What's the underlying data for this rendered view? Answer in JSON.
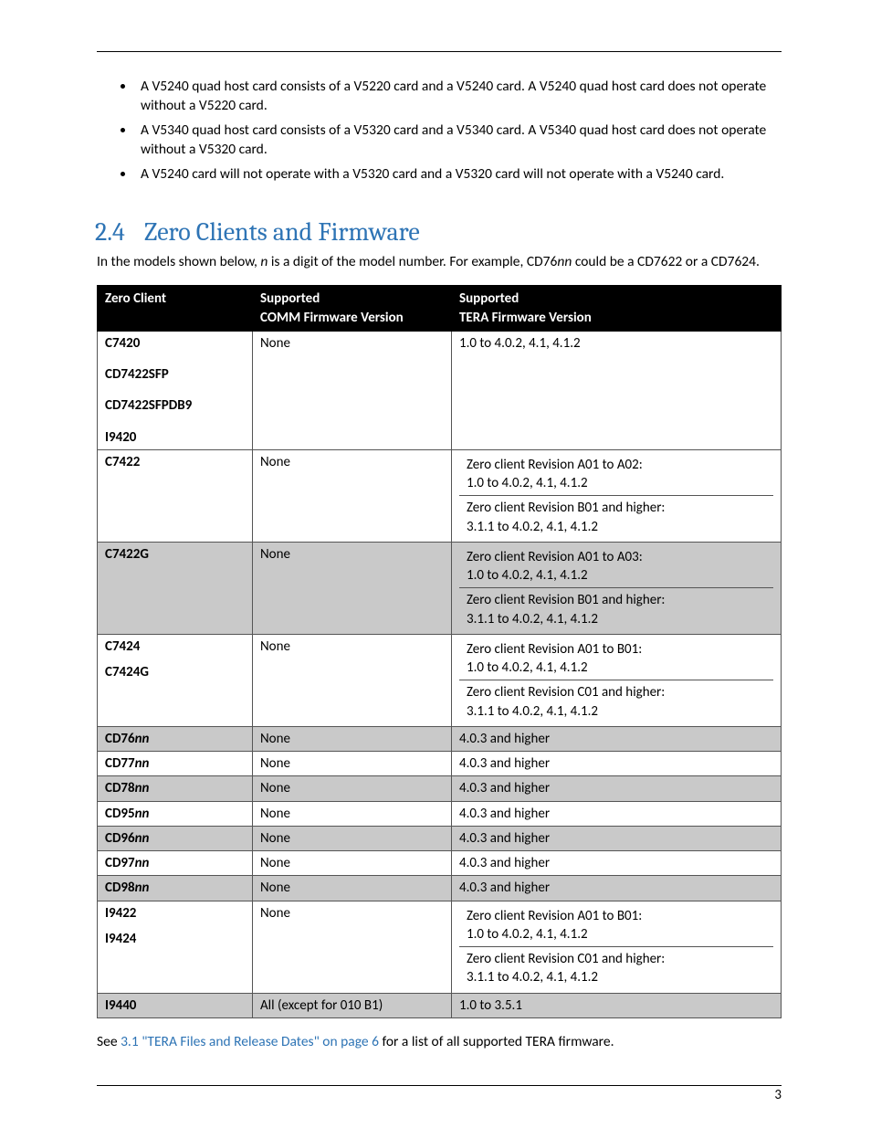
{
  "bullets": [
    "A V5240 quad host card consists of a V5220 card and a V5240 card.  A V5240 quad host card does not operate without a V5220 card.",
    "A V5340 quad host card consists of a V5320 card and a V5340 card.  A V5340 quad host card does not operate without a V5320 card.",
    "A V5240 card will not operate with a V5320 card and a V5320 card will not operate with a V5240 card."
  ],
  "section": {
    "num": "2.4",
    "title": "Zero Clients and Firmware"
  },
  "intro": {
    "a": "In the models shown below, ",
    "n": "n",
    "b": " is a digit of the model number. For example, CD76",
    "nn": "nn",
    "c": " could be a CD7622 or a CD7624."
  },
  "headers": {
    "zc": "Zero Client",
    "comm1": "Supported",
    "comm2": "COMM Firmware Version",
    "tera1": "Supported",
    "tera2": "TERA Firmware Version"
  },
  "rows": [
    {
      "alt": false,
      "models": [
        "C7420",
        "CD7422SFP",
        "CD7422SFPDB9",
        "I9420"
      ],
      "spacing": "loose",
      "comm": "None",
      "tera_flat": "1.0 to 4.0.2, 4.1, 4.1.2"
    },
    {
      "alt": false,
      "models": [
        "C7422"
      ],
      "comm": "None",
      "tera_split": [
        "Zero client Revision A01 to A02:",
        "1.0 to 4.0.2, 4.1, 4.1.2",
        "Zero client Revision B01 and higher:",
        "3.1.1 to 4.0.2, 4.1, 4.1.2"
      ]
    },
    {
      "alt": true,
      "models": [
        "C7422G"
      ],
      "comm": "None",
      "tera_split": [
        "Zero client Revision A01 to A03:",
        "1.0 to 4.0.2, 4.1, 4.1.2",
        "Zero client Revision B01 and higher:",
        "3.1.1 to 4.0.2, 4.1, 4.1.2"
      ]
    },
    {
      "alt": false,
      "models": [
        "C7424",
        "C7424G"
      ],
      "spacing": "tight",
      "comm": "None",
      "tera_split": [
        "Zero client Revision A01 to B01:",
        "1.0 to 4.0.2, 4.1, 4.1.2",
        "Zero client Revision C01 and higher:",
        "3.1.1 to 4.0.2, 4.1, 4.1.2"
      ]
    },
    {
      "alt": true,
      "models_nn": [
        "CD76"
      ],
      "comm": "None",
      "tera_flat": "4.0.3 and higher"
    },
    {
      "alt": false,
      "models_nn": [
        "CD77"
      ],
      "comm": "None",
      "tera_flat": "4.0.3 and higher"
    },
    {
      "alt": true,
      "models_nn": [
        "CD78"
      ],
      "comm": "None",
      "tera_flat": "4.0.3 and higher"
    },
    {
      "alt": false,
      "models_nn": [
        "CD95"
      ],
      "comm": "None",
      "tera_flat": "4.0.3 and higher"
    },
    {
      "alt": true,
      "models_nn": [
        "CD96"
      ],
      "comm": "None",
      "tera_flat": "4.0.3 and higher"
    },
    {
      "alt": false,
      "models_nn": [
        "CD97"
      ],
      "comm": "None",
      "tera_flat": "4.0.3 and higher"
    },
    {
      "alt": true,
      "models_nn": [
        "CD98"
      ],
      "comm": "None",
      "tera_flat": "4.0.3 and higher"
    },
    {
      "alt": false,
      "models": [
        "I9422",
        "I9424"
      ],
      "spacing": "tight",
      "comm": "None",
      "tera_split": [
        "Zero client Revision A01 to B01:",
        "1.0 to 4.0.2, 4.1, 4.1.2",
        "Zero client Revision C01 and higher:",
        "3.1.1 to 4.0.2, 4.1, 4.1.2"
      ]
    },
    {
      "alt": true,
      "models": [
        "I9440"
      ],
      "comm": "All (except for 010 B1)",
      "tera_flat": "1.0 to 3.5.1"
    }
  ],
  "footnote": {
    "a": "See ",
    "link": "3.1 \"TERA Files and Release Dates\" on page 6",
    "b": " for a list of all supported TERA firmware."
  },
  "pagenum": "3"
}
